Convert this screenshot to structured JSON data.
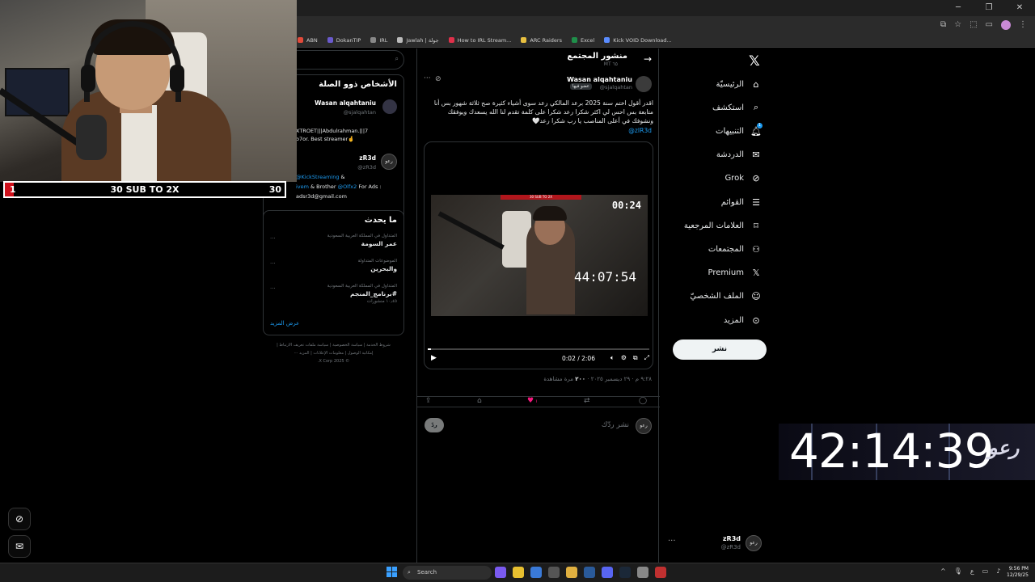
{
  "browser": {
    "bookmarks": [
      {
        "label": "ABN",
        "color": "#e34a3a"
      },
      {
        "label": "DokanTIP",
        "color": "#6a5acd"
      },
      {
        "label": "IRL",
        "color": "#888888"
      },
      {
        "label": "Jawlah | جولة",
        "color": "#bbbbbb"
      },
      {
        "label": "How to IRL Stream...",
        "color": "#e0304a"
      },
      {
        "label": "ARC Raiders",
        "color": "#e8c040"
      },
      {
        "label": "Excel",
        "color": "#1f8f4a"
      },
      {
        "label": "Kick VOID Download...",
        "color": "#5a8cff"
      }
    ]
  },
  "nav": {
    "items": [
      {
        "label": "الرئيسيّة",
        "icon": "home-icon"
      },
      {
        "label": "استكشف",
        "icon": "search-icon"
      },
      {
        "label": "التنبيهات",
        "icon": "bell-icon",
        "badge": "1"
      },
      {
        "label": "الدردشة",
        "icon": "mail-icon"
      },
      {
        "label": "Grok",
        "icon": "grok-icon"
      },
      {
        "label": "القوائم",
        "icon": "list-icon"
      },
      {
        "label": "العلامات المرجعية",
        "icon": "bookmark-icon"
      },
      {
        "label": "المجتمعات",
        "icon": "communities-icon"
      },
      {
        "label": "Premium",
        "icon": "x-logo-icon"
      },
      {
        "label": "الملف الشخصيّ",
        "icon": "profile-icon"
      },
      {
        "label": "المزيد",
        "icon": "more-icon"
      }
    ],
    "post_button": "نشر",
    "user": {
      "name": "zR3d",
      "handle": "@zR3d"
    }
  },
  "post": {
    "header_title": "منشور المجتمع",
    "header_sub": "MT ٦٥",
    "author_name": "Wasan alqahtaniu",
    "author_handle": "@sjalqahtan",
    "author_chip": "عضو فيها",
    "text": "اقدر أقول اختم سنة 2025 برعد المالكي رعد سوى أشياء كثيرة صح ثلاثة شهور بس أنا متابعة بس احس لي اكثر شكرا رعد شكرا على كلمة تقدم لنا الله يسعدك ويوفقك ونشوفك في أعلى المناصب يا رب شكرا رعد🤍",
    "mention": "@zIR3d",
    "video": {
      "timer_small": "00:24",
      "timer_big": "44:07:54",
      "top_label": "30 SUB TO 2X",
      "time": "0:02 / 2:06",
      "progress": 0.016
    },
    "meta_time": "٩:٢٨ م · ٢٩ ديسمبر ٢٠٢٥ · ",
    "meta_views": "٢٠٠",
    "meta_views_label": " مرة مشاهدة",
    "like_count": "١",
    "reply_placeholder": "نشر ردّك",
    "reply_button": "ردّ"
  },
  "sidebar": {
    "related_title": "الأشخاص ذوو الصلة",
    "user1_name": "Wasan alqahtaniu",
    "user1_handle": "@sjalqahtan",
    "user1_bio_l1": "XTROET|||Abdulrahman.|||7",
    "user1_bio_l2": "o7or. Best streamer🤞",
    "user2_name": "zR3d",
    "user2_handle": "@zR3d",
    "user2_bio_link1": "@KickStreaming",
    "user2_bio_amp": " &",
    "user2_bio_l2a": "ivem",
    "user2_bio_l2b": " & Brother ",
    "user2_bio_link2": "@Olfx2",
    "user2_bio_l2c": " For Ads :",
    "user2_bio_l3": "adsr3d@gmail.com",
    "trends_title": "ما يحدث",
    "trends": [
      {
        "context": "المتداول في المملكة العربية السعودية",
        "name": "عمر السومة",
        "count": ""
      },
      {
        "context": "الموضوعات المتداولة",
        "name": "والبحرين",
        "count": ""
      },
      {
        "context": "المتداول في المملكة العربية السعودية",
        "name": "#برنامج_المنجم",
        "count": "١٠٫٤٥ منشورات"
      }
    ],
    "show_more": "عرض المزيد",
    "footer_l1": "شروط الخدمة | سياسة الخصوصية | سياسة ملفات تعريف الارتباط |",
    "footer_l2": "إمكانية الوصول | معلومات الإعلانات | المزيد ···",
    "footer_l3": "© 2025 X Corp."
  },
  "overlay": {
    "sub_left": "1",
    "sub_mid": "30 SUB TO 2X",
    "sub_right": "30",
    "sub_progress": 0.033,
    "big_timer": "42:14:39",
    "logo": "رعو"
  },
  "taskbar": {
    "search": "Search",
    "time": "9:56 PM",
    "date": "12/29/25"
  }
}
